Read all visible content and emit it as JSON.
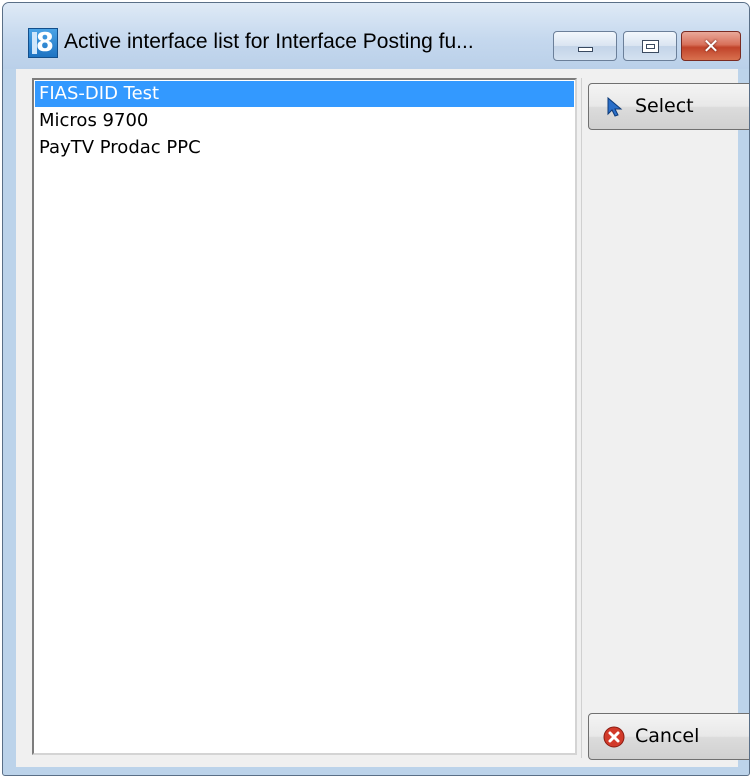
{
  "window": {
    "title": "Active interface list for Interface Posting fu...",
    "app_icon_text": "8",
    "controls": {
      "minimize": "minimize",
      "maximize": "maximize",
      "close": "✕"
    }
  },
  "list": {
    "items": [
      {
        "label": "FIAS-DID Test",
        "selected": true
      },
      {
        "label": "Micros 9700",
        "selected": false
      },
      {
        "label": "PayTV Prodac PPC",
        "selected": false
      }
    ]
  },
  "buttons": {
    "select": {
      "label": "Select",
      "icon": "cursor-arrow-icon"
    },
    "cancel": {
      "label": "Cancel",
      "icon": "cancel-x-circle-icon"
    }
  },
  "colors": {
    "selection": "#3399ff",
    "window_frame": "#bcd3ea",
    "close_button": "#c1432a"
  }
}
